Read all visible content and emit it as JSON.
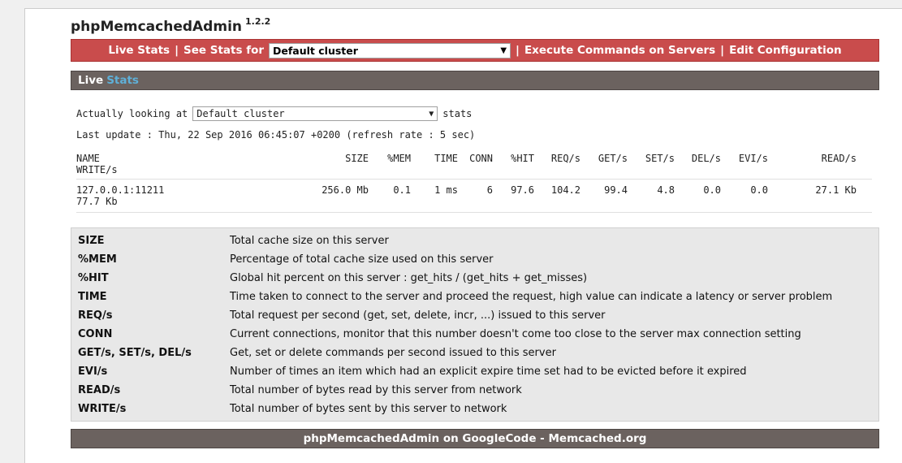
{
  "app": {
    "title": "phpMemcachedAdmin",
    "version": "1.2.2"
  },
  "menu": {
    "live_stats": "Live Stats",
    "see_stats_for": "See Stats for",
    "cluster_selected": "Default cluster",
    "execute": "Execute Commands on Servers",
    "edit_config": "Edit Configuration",
    "separator": "|"
  },
  "live_bar": {
    "live": "Live",
    "stats": "Stats"
  },
  "looking": {
    "prefix": "Actually looking at",
    "cluster_selected": "Default cluster",
    "suffix": "stats"
  },
  "last_update": "Last update : Thu, 22 Sep 2016 06:45:07 +0200 (refresh rate : 5 sec)",
  "table": {
    "headers": [
      "NAME",
      "SIZE",
      "%MEM",
      "TIME",
      "CONN",
      "%HIT",
      "REQ/s",
      "GET/s",
      "SET/s",
      "DEL/s",
      "EVI/s",
      "READ/s",
      "WRITE/s"
    ],
    "rows": [
      [
        "127.0.0.1:11211",
        "256.0 Mb",
        "0.1",
        "1 ms",
        "6",
        "97.6",
        "104.2",
        "99.4",
        "4.8",
        "0.0",
        "0.0",
        "27.1 Kb",
        "77.7 Kb"
      ]
    ]
  },
  "legend": [
    {
      "key": "SIZE",
      "desc": "Total cache size on this server"
    },
    {
      "key": "%MEM",
      "desc": "Percentage of total cache size used on this server"
    },
    {
      "key": "%HIT",
      "desc": "Global hit percent on this server : get_hits / (get_hits + get_misses)"
    },
    {
      "key": "TIME",
      "desc": "Time taken to connect to the server and proceed the request, high value can indicate a latency or server problem"
    },
    {
      "key": "REQ/s",
      "desc": "Total request per second (get, set, delete, incr, ...) issued to this server"
    },
    {
      "key": "CONN",
      "desc": "Current connections, monitor that this number doesn't come too close to the server max connection setting"
    },
    {
      "key": "GET/s, SET/s, DEL/s",
      "desc": "Get, set or delete commands per second issued to this server"
    },
    {
      "key": "EVI/s",
      "desc": "Number of times an item which had an explicit expire time set had to be evicted before it expired"
    },
    {
      "key": "READ/s",
      "desc": "Total number of bytes read by this server from network"
    },
    {
      "key": "WRITE/s",
      "desc": "Total number of bytes sent by this server to network"
    }
  ],
  "footer": "phpMemcachedAdmin on GoogleCode - Memcached.org",
  "colors": {
    "menu_red": "#c94c4c",
    "bar_brown": "#6b625f",
    "stats_blue": "#5fb0d8",
    "legend_bg": "#e8e8e8"
  }
}
